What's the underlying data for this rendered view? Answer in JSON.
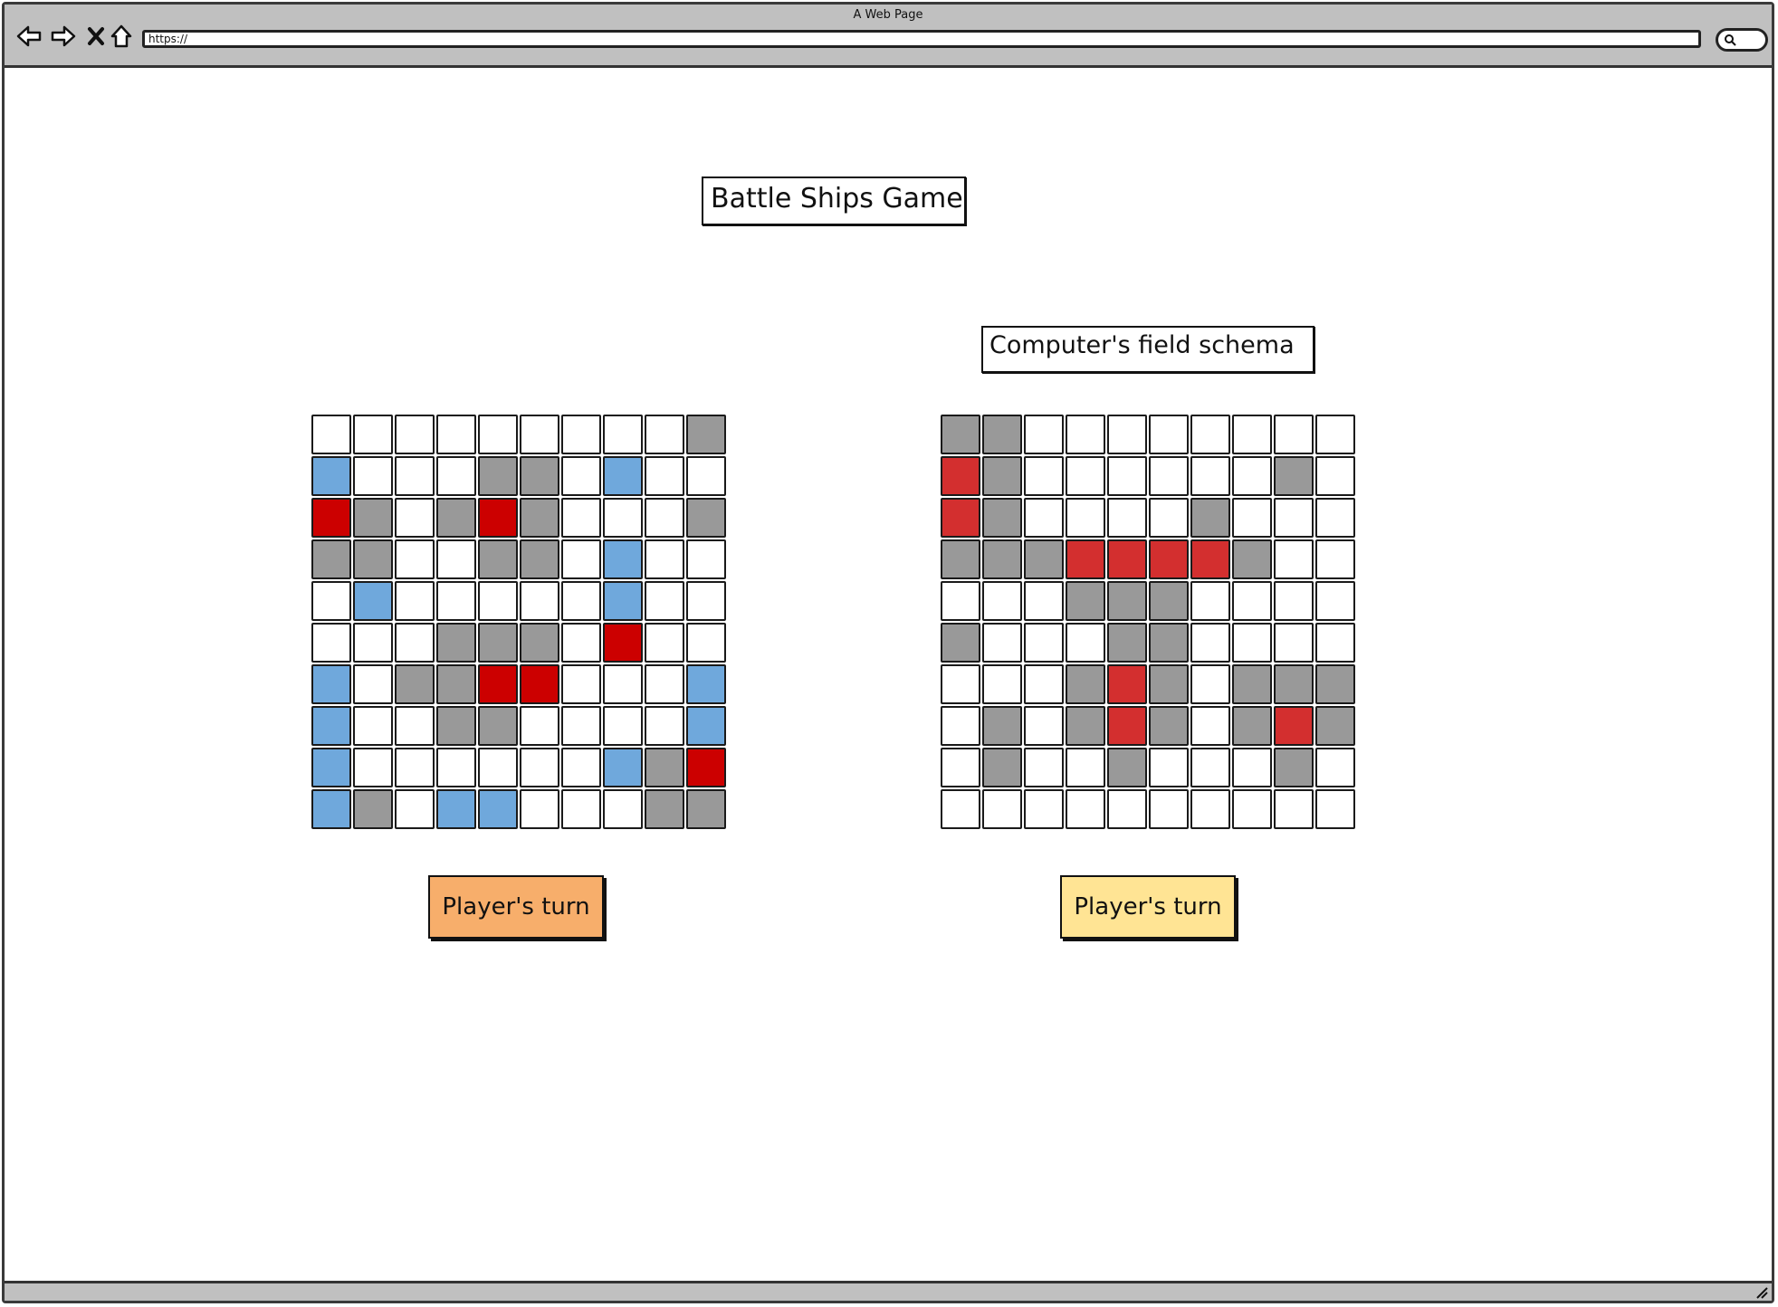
{
  "window": {
    "title": "A Web Page",
    "address": "https://"
  },
  "page": {
    "title": "Battle Ships Game",
    "computer_field_label": "Computer's field schema"
  },
  "player_board": {
    "cell_state_legend": {
      "e": "empty",
      "g": "grey",
      "b": "blue",
      "r": "red"
    },
    "rows": [
      "eeeeeeeeeg",
      "beeeggebee",
      "rgegrgeeeg",
      "ggeeggebee",
      "ebeeeeebee",
      "eeegggeree",
      "beggrreeeb",
      "beeggeeeeb",
      "beeeeeebgr",
      "bgebbeeegg"
    ]
  },
  "computer_board": {
    "cell_state_legend": {
      "e": "empty",
      "g": "grey",
      "R": "red"
    },
    "rows": [
      "ggeeeeeeee",
      "Rgeeeeeege",
      "Rgeeeegeee",
      "gggRRRRgee",
      "eeegggeeee",
      "geeeggeeee",
      "eeegRgeggg",
      "egegRgegRg",
      "egeegeeege",
      "eeeeeeeeee"
    ]
  },
  "buttons": {
    "left_turn": "Player's turn",
    "right_turn": "Player's turn"
  },
  "colors": {
    "grey": "#999999",
    "blue": "#6fa8dc",
    "red_player": "#cc0000",
    "red_computer": "#d32f2f",
    "left_button": "#f7ae6b",
    "right_button": "#ffe494",
    "chrome": "#c0c0c0"
  }
}
